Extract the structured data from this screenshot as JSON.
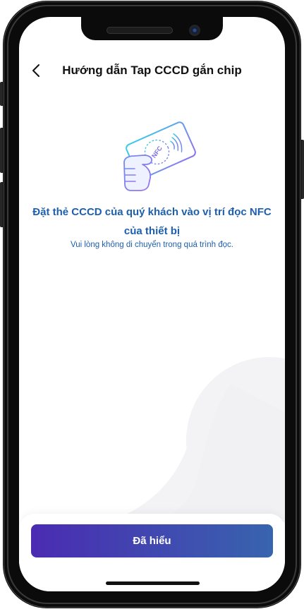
{
  "header": {
    "title": "Hướng dẫn Tap CCCD gắn chip",
    "back_icon": "chevron-left-icon"
  },
  "illustration": {
    "icon": "hand-tap-nfc-card-icon",
    "card_label": "NFC"
  },
  "instruction": {
    "title_line1": "Đặt thẻ CCCD của quý khách vào vị trí đọc NFC",
    "title_line2": "của thiết bị",
    "note": "Vui lòng không di chuyển trong quá trình đọc."
  },
  "footer": {
    "confirm_label": "Đã hiểu"
  },
  "colors": {
    "accent": "#1d5fae",
    "btn-start": "#4a2bb2",
    "btn-end": "#3864ae",
    "title": "#111111"
  }
}
